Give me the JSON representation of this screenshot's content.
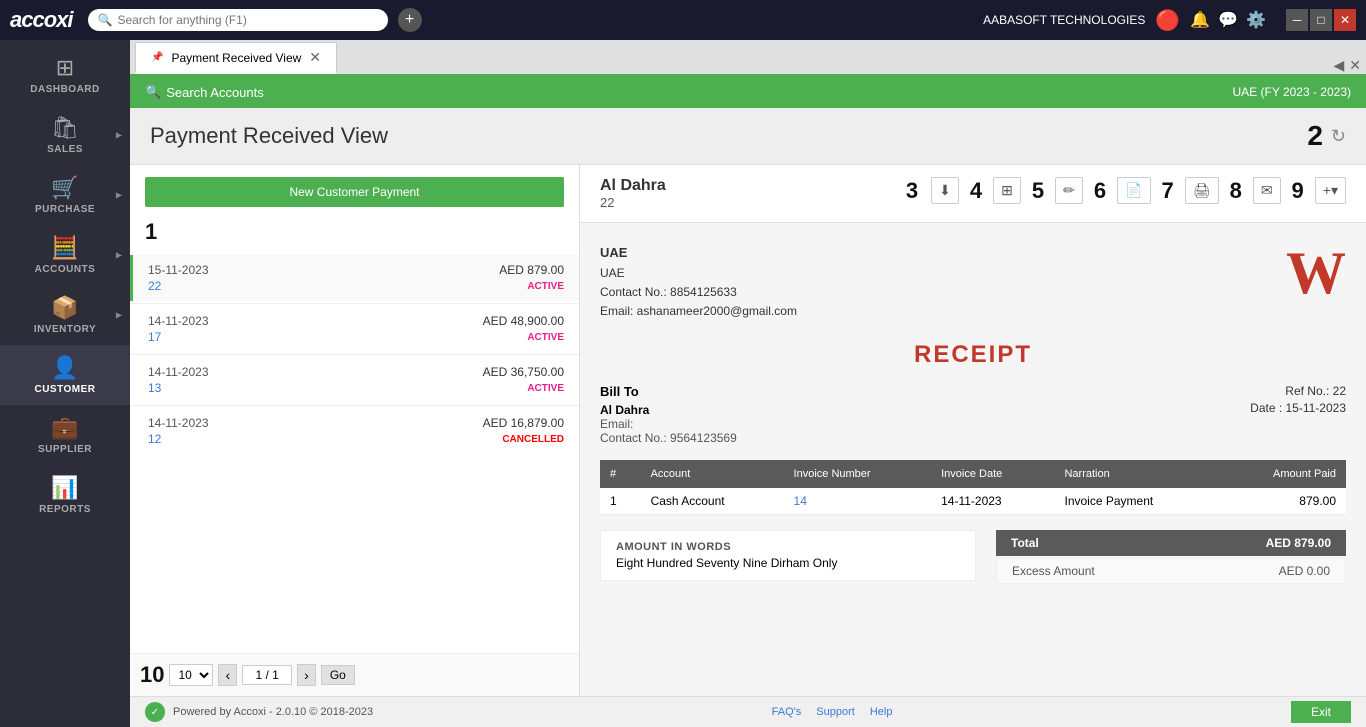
{
  "app": {
    "logo": "accoxi",
    "search_placeholder": "Search for anything (F1)"
  },
  "top_bar": {
    "company": "AABASOFT TECHNOLOGIES",
    "icons": [
      "bell",
      "message",
      "settings",
      "minimize",
      "maximize",
      "close"
    ]
  },
  "tabs": [
    {
      "label": "Payment Received View",
      "active": true
    }
  ],
  "green_bar": {
    "search_label": "Search Accounts",
    "fy_label": "UAE (FY 2023 - 2023)"
  },
  "page": {
    "title": "Payment Received View",
    "badge_2": "2",
    "new_payment_btn": "New Customer Payment"
  },
  "payments": [
    {
      "date": "15-11-2023",
      "amount": "AED 879.00",
      "ref": "22",
      "status": "ACTIVE",
      "selected": true
    },
    {
      "date": "14-11-2023",
      "amount": "AED 48,900.00",
      "ref": "17",
      "status": "ACTIVE",
      "selected": false
    },
    {
      "date": "14-11-2023",
      "amount": "AED 36,750.00",
      "ref": "13",
      "status": "ACTIVE",
      "selected": false
    },
    {
      "date": "14-11-2023",
      "amount": "AED 16,879.00",
      "ref": "12",
      "status": "CANCELLED",
      "selected": false
    }
  ],
  "pagination": {
    "page_size": "10",
    "prev": "<",
    "next": ">",
    "current_page": "1 / 1",
    "go_btn": "Go"
  },
  "receipt": {
    "account_name": "Al Dahra",
    "account_num": "22",
    "action_badge": "3",
    "badges": [
      "3",
      "4",
      "5",
      "6",
      "7",
      "8",
      "9"
    ],
    "company_name": "UAE",
    "company_country": "UAE",
    "contact": "Contact No.: 8854125633",
    "email": "Email: ashanameer2000@gmail.com",
    "title": "RECEIPT",
    "bill_to_label": "Bill To",
    "bill_to_name": "Al Dahra",
    "bill_to_email": "Email:",
    "bill_to_contact": "Contact No.: 9564123569",
    "ref_no": "Ref No.: 22",
    "date": "Date : 15-11-2023",
    "table_headers": [
      "#",
      "Account",
      "Invoice Number",
      "Invoice Date",
      "Narration",
      "Amount Paid"
    ],
    "table_rows": [
      {
        "num": "1",
        "account": "Cash Account",
        "invoice_number": "14",
        "invoice_date": "14-11-2023",
        "narration": "Invoice Payment",
        "amount": "879.00"
      }
    ],
    "amount_words_label": "AMOUNT IN WORDS",
    "amount_words": "Eight Hundred Seventy Nine Dirham Only",
    "total_label": "Total",
    "total_value": "AED 879.00",
    "excess_label": "Excess Amount"
  },
  "sidebar": {
    "items": [
      {
        "id": "dashboard",
        "label": "DASHBOARD",
        "icon": "⊞"
      },
      {
        "id": "sales",
        "label": "SALES",
        "icon": "🛒"
      },
      {
        "id": "purchase",
        "label": "PURCHASE",
        "icon": "🛒"
      },
      {
        "id": "accounts",
        "label": "ACCOUNTS",
        "icon": "🧮"
      },
      {
        "id": "inventory",
        "label": "INVENTORY",
        "icon": "📦"
      },
      {
        "id": "customer",
        "label": "CUSTOMER",
        "icon": "👤",
        "active": true
      },
      {
        "id": "supplier",
        "label": "SUPPLIER",
        "icon": "💼"
      },
      {
        "id": "reports",
        "label": "REPORTS",
        "icon": "📊"
      }
    ]
  },
  "footer": {
    "powered_by": "Powered by Accoxi - 2.0.10 © 2018-2023",
    "faq": "FAQ's",
    "support": "Support",
    "help": "Help",
    "exit": "Exit"
  }
}
